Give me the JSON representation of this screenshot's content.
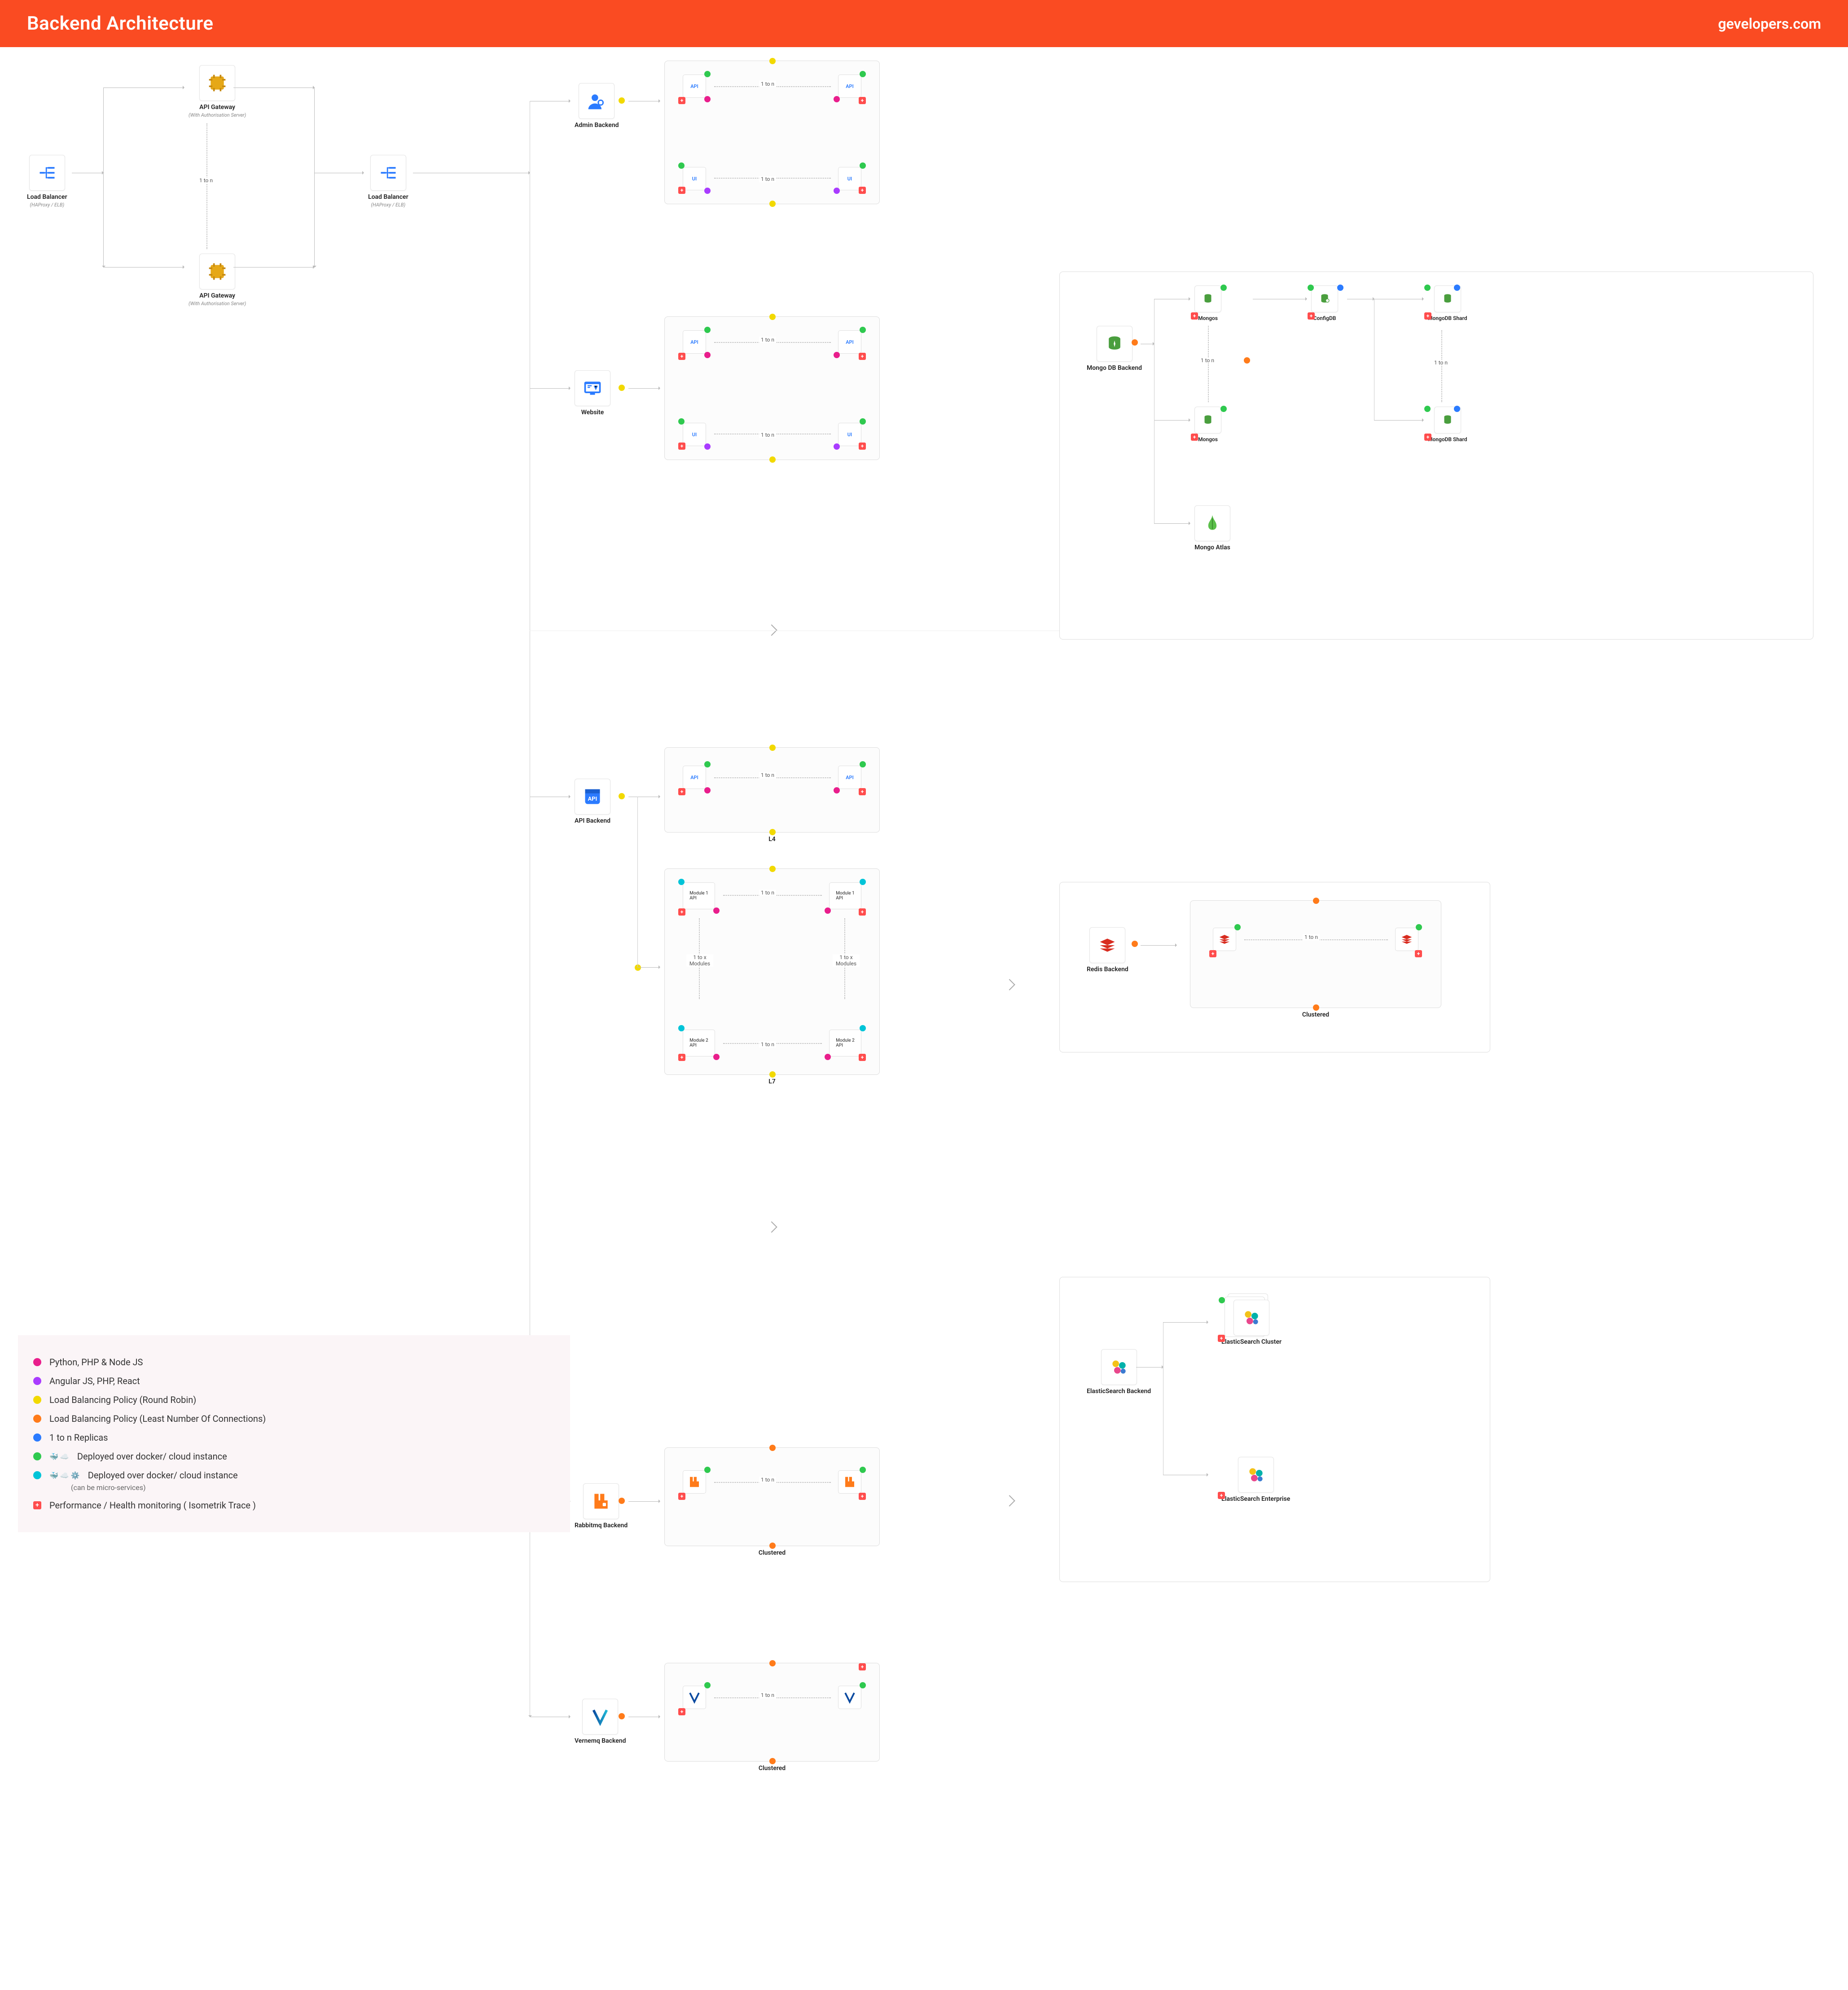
{
  "header": {
    "title": "Backend Architecture",
    "brand": "gevelopers.com"
  },
  "nodes": {
    "lb1": {
      "label": "Load Balancer",
      "sub": "(HAProxy / ELB)"
    },
    "agw1": {
      "label": "API Gateway",
      "sub": "(With Authorisation Server)"
    },
    "agw2": {
      "label": "API Gateway",
      "sub": "(With Authorisation Server)"
    },
    "lb2": {
      "label": "Load Balancer",
      "sub": "(HAProxy / ELB)"
    },
    "admin": {
      "label": "Admin Backend"
    },
    "website": {
      "label": "Website"
    },
    "api_backend": {
      "label": "API Backend"
    },
    "rabbitmq": {
      "label": "Rabbitmq Backend"
    },
    "vernemq": {
      "label": "Vernemq Backend"
    },
    "mongo": {
      "label": "Mongo DB Backend"
    },
    "mongos1": {
      "label": "Mongos"
    },
    "mongos2": {
      "label": "Mongos"
    },
    "configdb": {
      "label": "ConfigDB"
    },
    "shard1": {
      "label": "MongoDB Shard"
    },
    "shard2": {
      "label": "MongoDB Shard"
    },
    "mongo_atlas": {
      "label": "Mongo Atlas"
    },
    "redis": {
      "label": "Redis Backend"
    },
    "es_backend": {
      "label": "ElasticSearch Backend"
    },
    "es_cluster": {
      "label": "ElasticSearch Cluster"
    },
    "es_enterprise": {
      "label": "ElasticSearch Enterprise"
    }
  },
  "clusters": {
    "api_ui": {
      "items": [
        "API",
        "API",
        "UI",
        "UI"
      ],
      "conn": "1 to n"
    },
    "l4": {
      "label": "L4",
      "items": [
        "API",
        "API"
      ],
      "conn": "1 to n"
    },
    "l7": {
      "label": "L7",
      "items": [
        "Module 1 API",
        "Module 1 API",
        "Module 2 API",
        "Module 2 API"
      ],
      "conn": "1 to n",
      "mods": "1 to x Modules"
    },
    "clustered": {
      "label": "Clustered",
      "conn": "1 to n"
    }
  },
  "conn": {
    "one_to_n": "1 to n",
    "one_to_x": "1 to x Modules"
  },
  "legend": [
    {
      "color": "#e91e8c",
      "text": "Python, PHP & Node JS"
    },
    {
      "color": "#a93cff",
      "text": "Angular JS, PHP, React"
    },
    {
      "color": "#f2d900",
      "text": "Load Balancing Policy (Round Robin)"
    },
    {
      "color": "#ff7b1a",
      "text": "Load Balancing Policy (Least Number Of Connections)"
    },
    {
      "color": "#2b7bff",
      "text": "1 to n Replicas"
    },
    {
      "color": "#2fc94f",
      "text": "Deployed over docker/ cloud instance",
      "icons": true
    },
    {
      "color": "#00c4d8",
      "text": "Deployed over docker/ cloud instance",
      "sub": "(can be micro-services)",
      "icons": true
    },
    {
      "plus": true,
      "text": "Performance / Health monitoring ( Isometrik Trace )"
    }
  ]
}
